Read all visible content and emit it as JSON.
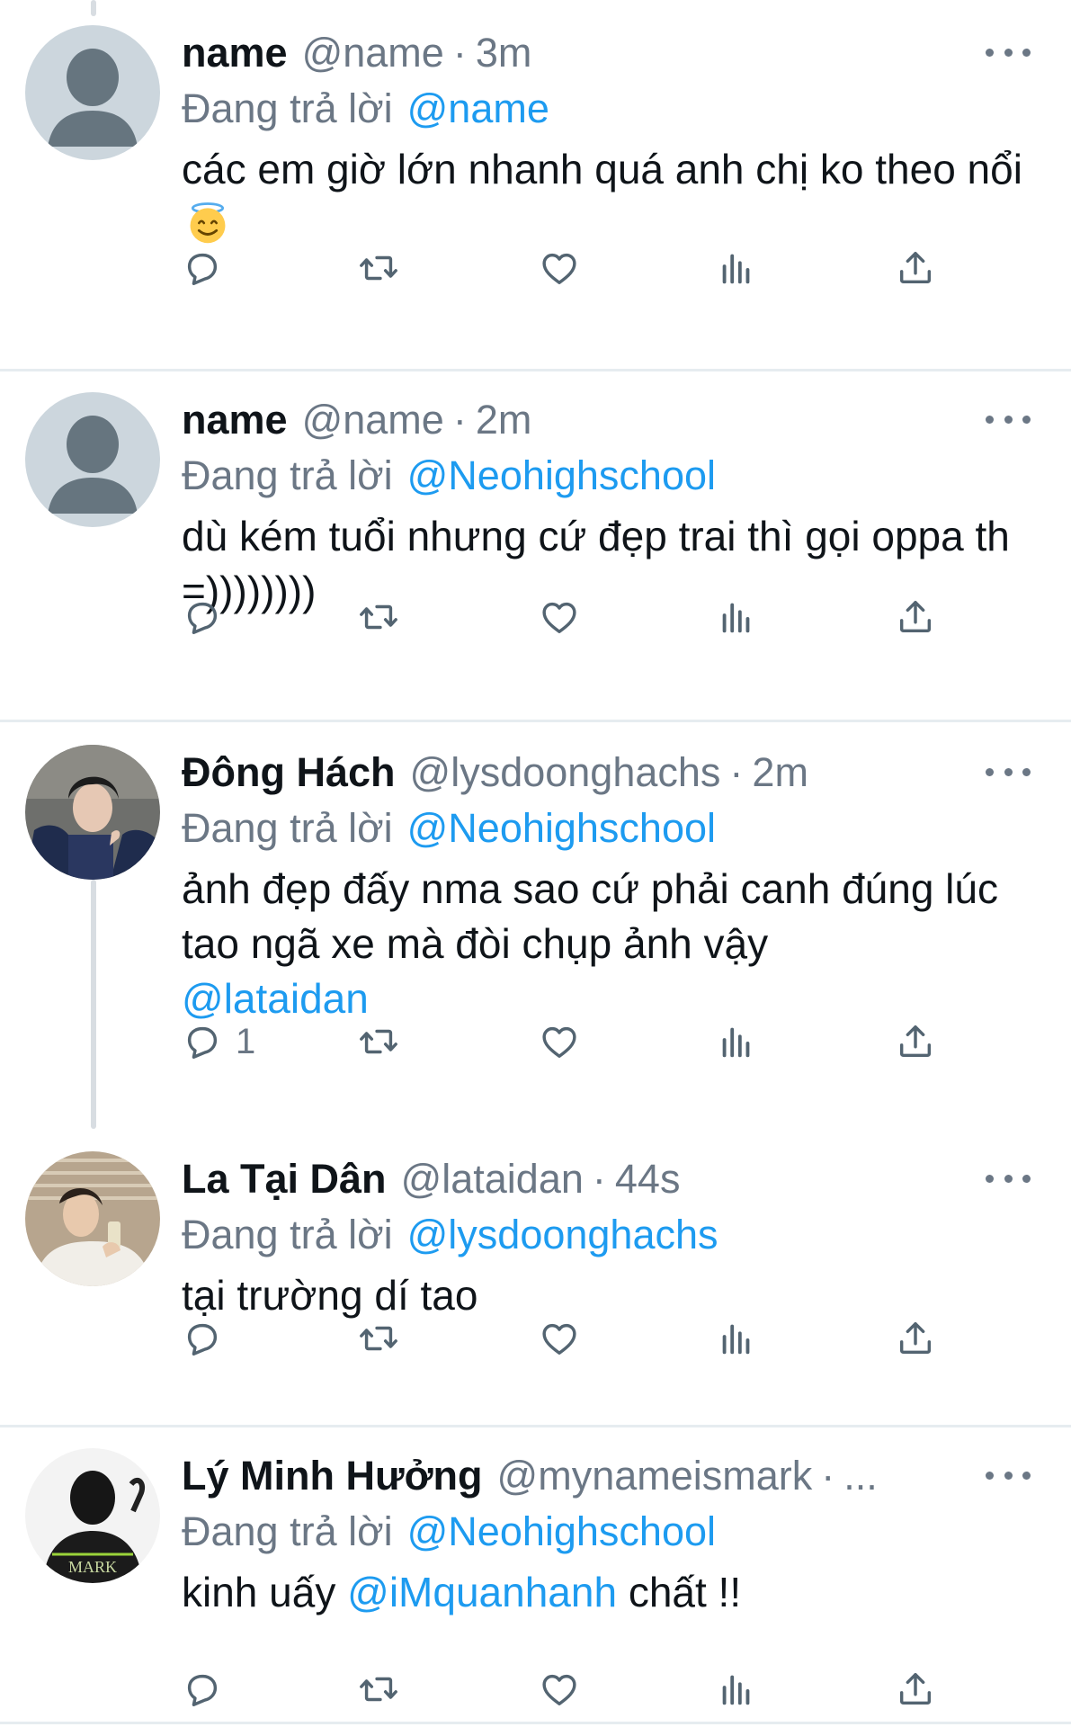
{
  "tweets": [
    {
      "name": "name",
      "handle": "@name",
      "time": "3m",
      "reply_label": "Đang trả lời",
      "reply_to": "@name",
      "text": "các em giờ lớn nhanh quá anh chị ko theo nổi",
      "emoji": "smiling-face-with-halo",
      "avatar": "default-avatar",
      "reply_count": ""
    },
    {
      "name": "name",
      "handle": "@name",
      "time": "2m",
      "reply_label": "Đang trả lời",
      "reply_to": "@Neohighschool",
      "text": "dù kém tuổi nhưng cứ đẹp trai thì gọi oppa th =))))))))",
      "avatar": "default-avatar",
      "reply_count": ""
    },
    {
      "name": "Đông Hách",
      "handle": "@lysdoonghachs",
      "time": "2m",
      "reply_label": "Đang trả lời",
      "reply_to": "@Neohighschool",
      "text": "ảnh đẹp đấy nma sao cứ phải canh đúng lúc tao ngã xe mà đòi chụp ảnh vậy",
      "text_mention": "@lataidan",
      "avatar": "photo-avatar",
      "reply_count": "1"
    },
    {
      "name": "La Tại Dân",
      "handle": "@lataidan",
      "time": "44s",
      "reply_label": "Đang trả lời",
      "reply_to": "@lysdoonghachs",
      "text": "tại trường dí tao",
      "avatar": "photo-avatar",
      "reply_count": ""
    },
    {
      "name": "Lý Minh Hưởng",
      "handle": "@mynameismark",
      "time": "...",
      "reply_label": "Đang trả lời",
      "reply_to": "@Neohighschool",
      "text_before": "kinh uấy",
      "text_mention": "@iMquanhanh",
      "text_after": "chất !!",
      "avatar": "photo-avatar",
      "reply_count": ""
    }
  ],
  "separator": "·",
  "colors": {
    "link": "#1d9bf0",
    "muted": "#6b7785",
    "text": "#0f1419",
    "divider": "#e6ecf0"
  },
  "icons": [
    "reply-icon",
    "retweet-icon",
    "like-icon",
    "views-icon",
    "share-icon",
    "more-icon"
  ]
}
